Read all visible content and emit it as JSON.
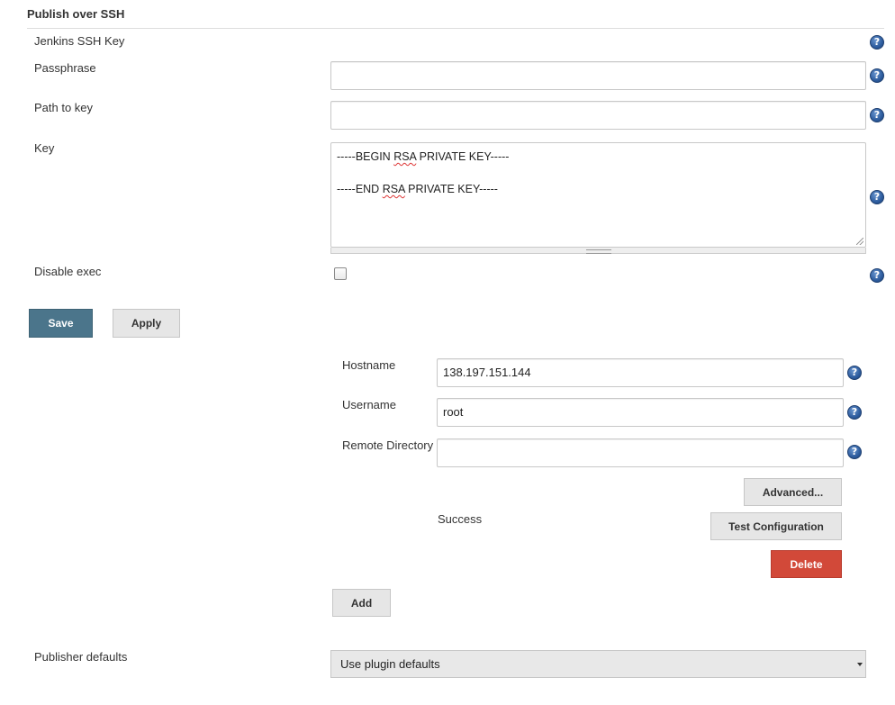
{
  "section": {
    "title": "Publish over SSH"
  },
  "labels": {
    "jenkins_ssh_key": "Jenkins SSH Key",
    "passphrase": "Passphrase",
    "path_to_key": "Path to key",
    "key": "Key",
    "disable_exec": "Disable exec",
    "hostname": "Hostname",
    "username": "Username",
    "remote_directory": "Remote Directory",
    "publisher_defaults": "Publisher defaults"
  },
  "fields": {
    "passphrase": "",
    "path_to_key": "",
    "key_begin_prefix": "-----BEGIN ",
    "key_rsa": "RSA",
    "key_begin_suffix": " PRIVATE KEY-----",
    "key_end_prefix": "-----END ",
    "key_end_suffix": " PRIVATE KEY-----",
    "disable_exec_checked": false,
    "hostname": "138.197.151.144",
    "username": "root",
    "remote_directory": ""
  },
  "buttons": {
    "save": "Save",
    "apply": "Apply",
    "advanced": "Advanced...",
    "test_configuration": "Test Configuration",
    "delete": "Delete",
    "add": "Add"
  },
  "status": {
    "test_result": "Success"
  },
  "publisher_defaults": {
    "selected": "Use plugin defaults"
  },
  "help_glyph": "?",
  "icons": {
    "help": "help-icon"
  },
  "colors": {
    "primary": "#4b758b",
    "danger": "#d24939",
    "help": "#2d5c9e"
  }
}
